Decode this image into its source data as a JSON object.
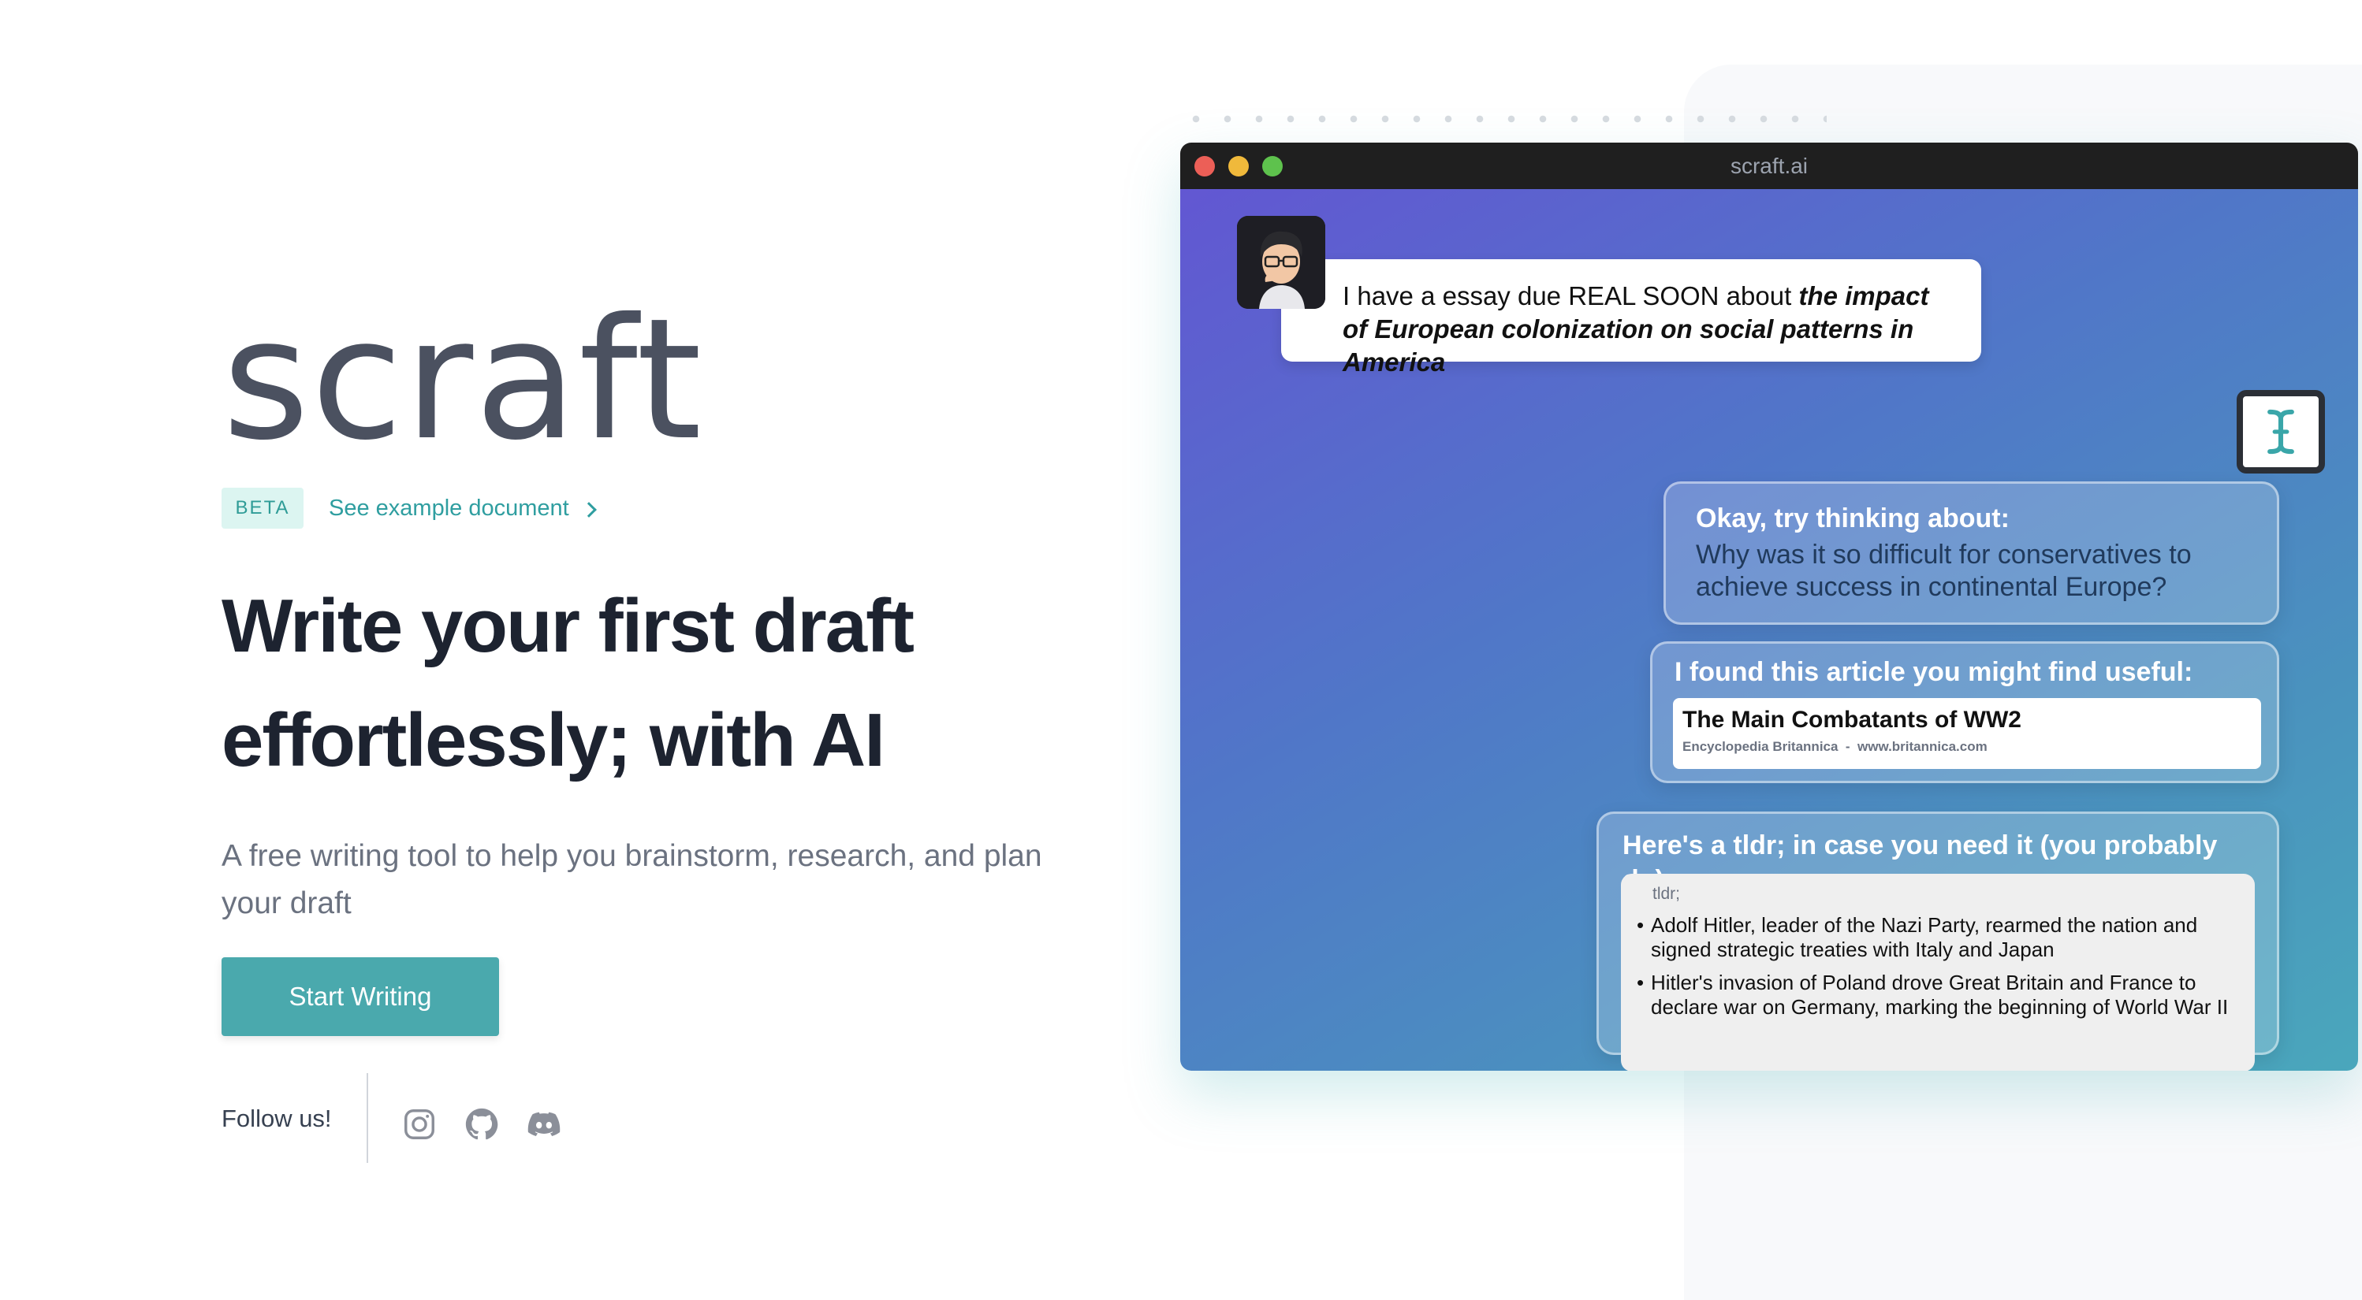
{
  "brand": {
    "logo_text": "scraft"
  },
  "hero": {
    "badge": "BETA",
    "example_link": "See example document",
    "headline_line1": "Write your first draft",
    "headline_line2": "effortlessly; with AI",
    "subline": "A free writing tool to help you brainstorm, research, and plan your draft",
    "cta_label": "Start Writing",
    "follow_label": "Follow us!"
  },
  "social": [
    {
      "icon": "instagram-icon"
    },
    {
      "icon": "github-icon"
    },
    {
      "icon": "discord-icon"
    }
  ],
  "window": {
    "title": "scraft.ai",
    "user_message": {
      "plain": "I have a essay due REAL SOON about",
      "emphasis": "the impact of European colonization on social patterns in America"
    },
    "suggestion_card": {
      "heading": "Okay, try thinking about:",
      "question": "Why was it so difficult for conservatives to achieve success in continental Europe?"
    },
    "article_card": {
      "heading": "I found this article you might find useful:",
      "article_title": "The Main Combatants of WW2",
      "article_source": "Encyclopedia Britannica",
      "article_separator": "-",
      "article_url": "www.britannica.com"
    },
    "tldr_card": {
      "heading": "Here's a tldr; in case you need it (you probably do)",
      "label": "tldr;",
      "bullets": [
        "Adolf Hitler, leader of the Nazi Party, rearmed the nation and signed strategic treaties with Italy and Japan",
        "Hitler's invasion of Poland drove Great Britain and France to declare war on Germany, marking the beginning of World War II"
      ]
    }
  },
  "colors": {
    "accent": "#4aa9ad",
    "badge_bg": "#dcf5f1",
    "heading": "#1d2330",
    "gradient_start": "#6257d2",
    "gradient_end": "#4aa7bc"
  }
}
